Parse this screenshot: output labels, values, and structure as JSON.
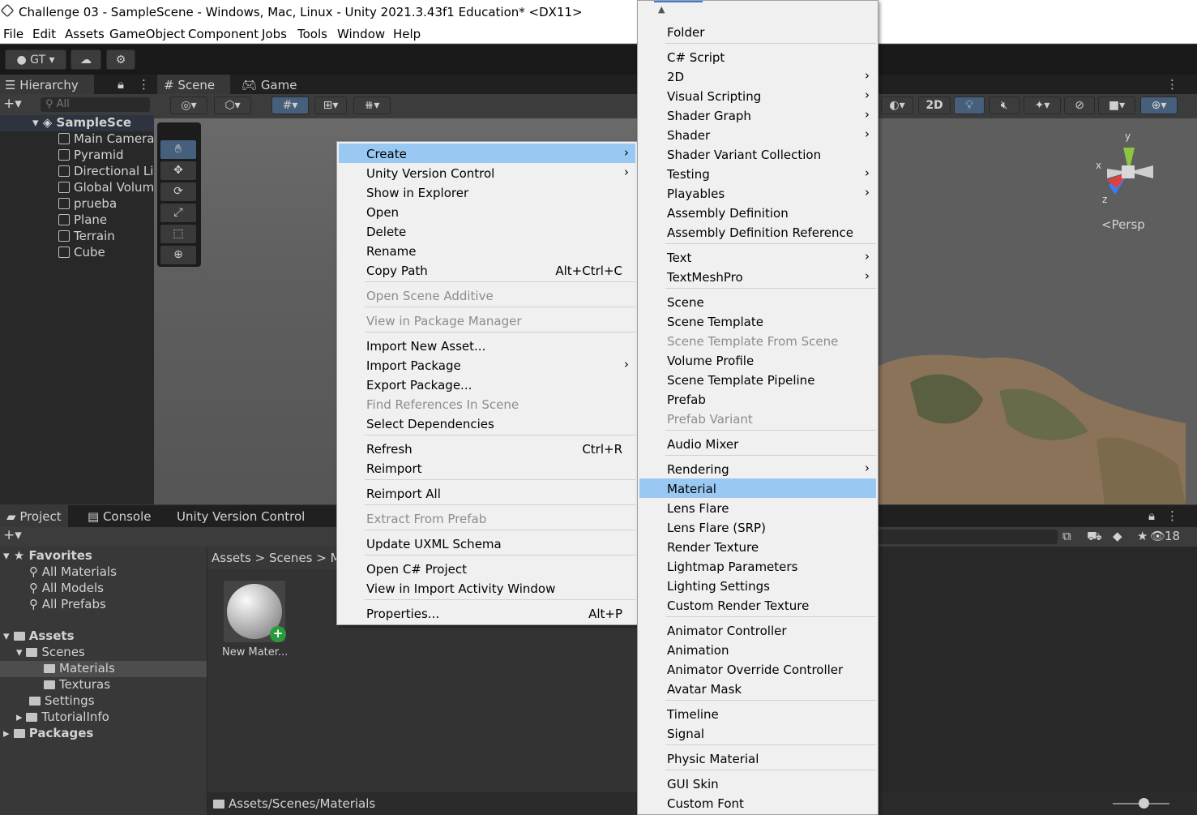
{
  "window": {
    "title": "Challenge 03 - SampleScene - Windows, Mac, Linux - Unity 2021.3.43f1 Education* <DX11>"
  },
  "menubar": [
    "File",
    "Edit",
    "Assets",
    "GameObject",
    "Component",
    "Jobs",
    "Tools",
    "Window",
    "Help"
  ],
  "toolbar": {
    "account": "GT",
    "view_2d": "2D"
  },
  "hierarchy": {
    "tab": "Hierarchy",
    "search_placeholder": "All",
    "scene": "SampleSce",
    "items": [
      "Main Camera",
      "Pyramid",
      "Directional Li",
      "Global Volum",
      "prueba",
      "Plane",
      "Terrain",
      "Cube"
    ]
  },
  "scene_tabs": {
    "scene": "Scene",
    "game": "Game",
    "persp": "<Persp"
  },
  "project": {
    "tabs": [
      "Project",
      "Console",
      "Unity Version Control"
    ],
    "favorites_label": "Favorites",
    "favorites": [
      "All Materials",
      "All Models",
      "All Prefabs"
    ],
    "assets_label": "Assets",
    "scenes": "Scenes",
    "materials": "Materials",
    "texturas": "Texturas",
    "settings": "Settings",
    "tutorialinfo": "TutorialInfo",
    "packages": "Packages",
    "breadcrumb": [
      "Assets",
      "Scenes",
      "M"
    ],
    "asset_name": "New Mater...",
    "path": "Assets/Scenes/Materials",
    "visible_count": "18"
  },
  "context_menu": [
    {
      "label": "Create",
      "arrow": true,
      "hl": true
    },
    {
      "label": "Unity Version Control",
      "arrow": true
    },
    {
      "label": "Show in Explorer"
    },
    {
      "label": "Open"
    },
    {
      "label": "Delete"
    },
    {
      "label": "Rename"
    },
    {
      "label": "Copy Path",
      "shortcut": "Alt+Ctrl+C"
    },
    {
      "sep": true
    },
    {
      "label": "Open Scene Additive",
      "dis": true
    },
    {
      "sep": true
    },
    {
      "label": "View in Package Manager",
      "dis": true
    },
    {
      "sep": true
    },
    {
      "label": "Import New Asset..."
    },
    {
      "label": "Import Package",
      "arrow": true
    },
    {
      "label": "Export Package..."
    },
    {
      "label": "Find References In Scene",
      "dis": true
    },
    {
      "label": "Select Dependencies"
    },
    {
      "sep": true
    },
    {
      "label": "Refresh",
      "shortcut": "Ctrl+R"
    },
    {
      "label": "Reimport"
    },
    {
      "sep": true
    },
    {
      "label": "Reimport All"
    },
    {
      "sep": true
    },
    {
      "label": "Extract From Prefab",
      "dis": true
    },
    {
      "sep": true
    },
    {
      "label": "Update UXML Schema"
    },
    {
      "sep": true
    },
    {
      "label": "Open C# Project"
    },
    {
      "label": "View in Import Activity Window"
    },
    {
      "sep": true
    },
    {
      "label": "Properties...",
      "shortcut": "Alt+P"
    }
  ],
  "create_menu": [
    {
      "label": "Folder"
    },
    {
      "sep": true
    },
    {
      "label": "C# Script"
    },
    {
      "label": "2D",
      "arrow": true
    },
    {
      "label": "Visual Scripting",
      "arrow": true
    },
    {
      "label": "Shader Graph",
      "arrow": true
    },
    {
      "label": "Shader",
      "arrow": true
    },
    {
      "label": "Shader Variant Collection"
    },
    {
      "label": "Testing",
      "arrow": true
    },
    {
      "label": "Playables",
      "arrow": true
    },
    {
      "label": "Assembly Definition"
    },
    {
      "label": "Assembly Definition Reference"
    },
    {
      "sep": true
    },
    {
      "label": "Text",
      "arrow": true
    },
    {
      "label": "TextMeshPro",
      "arrow": true
    },
    {
      "sep": true
    },
    {
      "label": "Scene"
    },
    {
      "label": "Scene Template"
    },
    {
      "label": "Scene Template From Scene",
      "dis": true
    },
    {
      "label": "Volume Profile"
    },
    {
      "label": "Scene Template Pipeline"
    },
    {
      "label": "Prefab"
    },
    {
      "label": "Prefab Variant",
      "dis": true
    },
    {
      "sep": true
    },
    {
      "label": "Audio Mixer"
    },
    {
      "sep": true
    },
    {
      "label": "Rendering",
      "arrow": true
    },
    {
      "label": "Material",
      "hl": true
    },
    {
      "label": "Lens Flare"
    },
    {
      "label": "Lens Flare (SRP)"
    },
    {
      "label": "Render Texture"
    },
    {
      "label": "Lightmap Parameters"
    },
    {
      "label": "Lighting Settings"
    },
    {
      "label": "Custom Render Texture"
    },
    {
      "sep": true
    },
    {
      "label": "Animator Controller"
    },
    {
      "label": "Animation"
    },
    {
      "label": "Animator Override Controller"
    },
    {
      "label": "Avatar Mask"
    },
    {
      "sep": true
    },
    {
      "label": "Timeline"
    },
    {
      "label": "Signal"
    },
    {
      "sep": true
    },
    {
      "label": "Physic Material"
    },
    {
      "sep": true
    },
    {
      "label": "GUI Skin"
    },
    {
      "label": "Custom Font"
    }
  ],
  "colors": {
    "highlight": "#99c9f3",
    "panel": "#383838",
    "dark": "#282828"
  }
}
